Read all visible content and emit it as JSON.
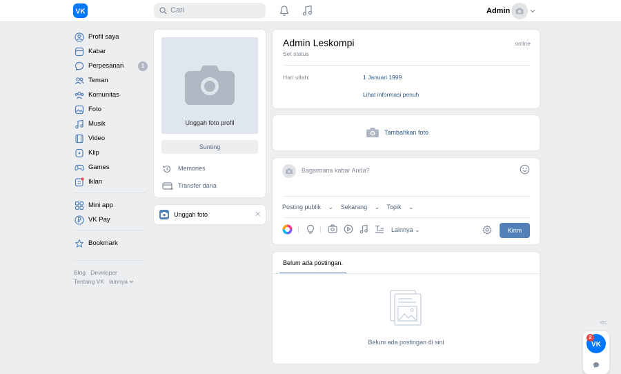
{
  "header": {
    "logo": "vk-logo",
    "search_placeholder": "Cari",
    "user_name": "Admin"
  },
  "nav": {
    "items": [
      {
        "label": "Profil saya",
        "icon": "user-circle-icon"
      },
      {
        "label": "Kabar",
        "icon": "news-icon"
      },
      {
        "label": "Perpesanan",
        "icon": "message-icon",
        "badge": "1"
      },
      {
        "label": "Teman",
        "icon": "friends-icon"
      },
      {
        "label": "Komunitas",
        "icon": "communities-icon"
      },
      {
        "label": "Foto",
        "icon": "photo-icon"
      },
      {
        "label": "Musik",
        "icon": "music-icon"
      },
      {
        "label": "Video",
        "icon": "video-icon"
      },
      {
        "label": "Klip",
        "icon": "clips-icon"
      },
      {
        "label": "Games",
        "icon": "gamepad-icon"
      },
      {
        "label": "Iklan",
        "icon": "ads-icon"
      }
    ],
    "secondary": [
      {
        "label": "Mini app",
        "icon": "apps-icon"
      },
      {
        "label": "VK Pay",
        "icon": "vkpay-icon"
      }
    ],
    "bookmark": {
      "label": "Bookmark",
      "icon": "star-icon"
    },
    "footer": {
      "blog": "Blog",
      "developer": "Developer",
      "about": "Tentang VK",
      "more": "lainnya"
    }
  },
  "left_column": {
    "photo_caption": "Unggah foto profil",
    "edit_button": "Sunting",
    "memories": "Memories",
    "transfer": "Transfer dana",
    "upload_photo": "Unggah foto"
  },
  "profile": {
    "name": "Admin Leskompi",
    "set_status": "Set status",
    "status": "online",
    "birthday_label": "Hari ultah:",
    "birthday_value": "1 Januari 1999",
    "full_info": "Lihat informasi penuh"
  },
  "add_photo": "Tambahkan foto",
  "composer": {
    "placeholder": "Bagaimana kabar Anda?",
    "post_public": "Posting publik",
    "now": "Sekarang",
    "topic": "Topik",
    "more": "Lainnya",
    "send": "Kirim"
  },
  "wall": {
    "tab": "Belum ada postingan.",
    "empty_text": "Belum ada postingan di sini"
  },
  "widget": {
    "count": "2"
  },
  "colors": {
    "brand": "#0077ff",
    "accent": "#5181b8",
    "link": "#2a5885",
    "background": "#edeef0"
  }
}
